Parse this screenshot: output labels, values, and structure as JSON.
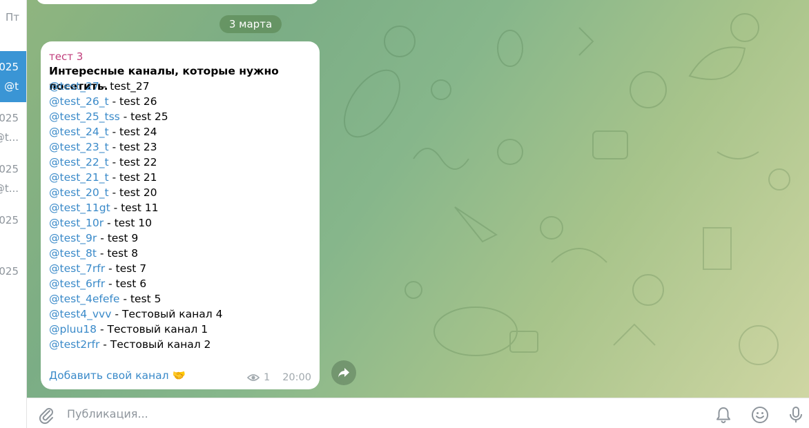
{
  "sidebar": {
    "top_text": "Пт",
    "items": [
      {
        "line1": "025",
        "line2": "@t",
        "active": true
      },
      {
        "line1": "025",
        "line2": "@t...",
        "active": false
      },
      {
        "line1": "025",
        "line2": "@t...",
        "active": false
      },
      {
        "line1": "025",
        "line2": "",
        "active": false
      },
      {
        "line1": "025",
        "line2": "",
        "active": false
      }
    ]
  },
  "chat": {
    "date_label": "3 марта",
    "message": {
      "author": "тест 3",
      "title": "Интересные каналы, которые нужно посетить.",
      "channels": [
        {
          "handle": "@test_27",
          "name": " - test_27"
        },
        {
          "handle": "@test_26_t",
          "name": " - test 26"
        },
        {
          "handle": "@test_25_tss",
          "name": " - test 25"
        },
        {
          "handle": "@test_24_t",
          "name": " - test 24"
        },
        {
          "handle": "@test_23_t",
          "name": " - test 23"
        },
        {
          "handle": "@test_22_t",
          "name": " - test 22"
        },
        {
          "handle": "@test_21_t",
          "name": " - test 21"
        },
        {
          "handle": "@test_20_t",
          "name": " - test 20"
        },
        {
          "handle": "@test_11gt",
          "name": " - test 11"
        },
        {
          "handle": "@test_10r",
          "name": " - test 10"
        },
        {
          "handle": "@test_9r",
          "name": " - test 9"
        },
        {
          "handle": "@test_8t",
          "name": " - test 8"
        },
        {
          "handle": "@test_7rfr",
          "name": " - test 7"
        },
        {
          "handle": "@test_6rfr",
          "name": " - test 6"
        },
        {
          "handle": "@test_4efefe",
          "name": " - test 5"
        },
        {
          "handle": "@test4_vvv",
          "name": " - Тестовый канал 4"
        },
        {
          "handle": "@pluu18",
          "name": " - Тестовый канал 1"
        },
        {
          "handle": "@test2rfr",
          "name": " - Тестовый канал 2"
        }
      ],
      "add_link": "Добавить свой канал",
      "add_emoji": "🤝",
      "views": "1",
      "time": "20:00"
    }
  },
  "composer": {
    "placeholder": "Публикация..."
  },
  "icons": {
    "attach": "paperclip-icon",
    "bell": "bell-icon",
    "emoji": "smiley-icon",
    "mic": "microphone-icon",
    "forward": "share-arrow-icon",
    "views": "eye-icon"
  },
  "colors": {
    "accent": "#3a95d5",
    "link": "#3a8ac9",
    "author": "#c03d7b",
    "meta": "#a0a8ad"
  }
}
